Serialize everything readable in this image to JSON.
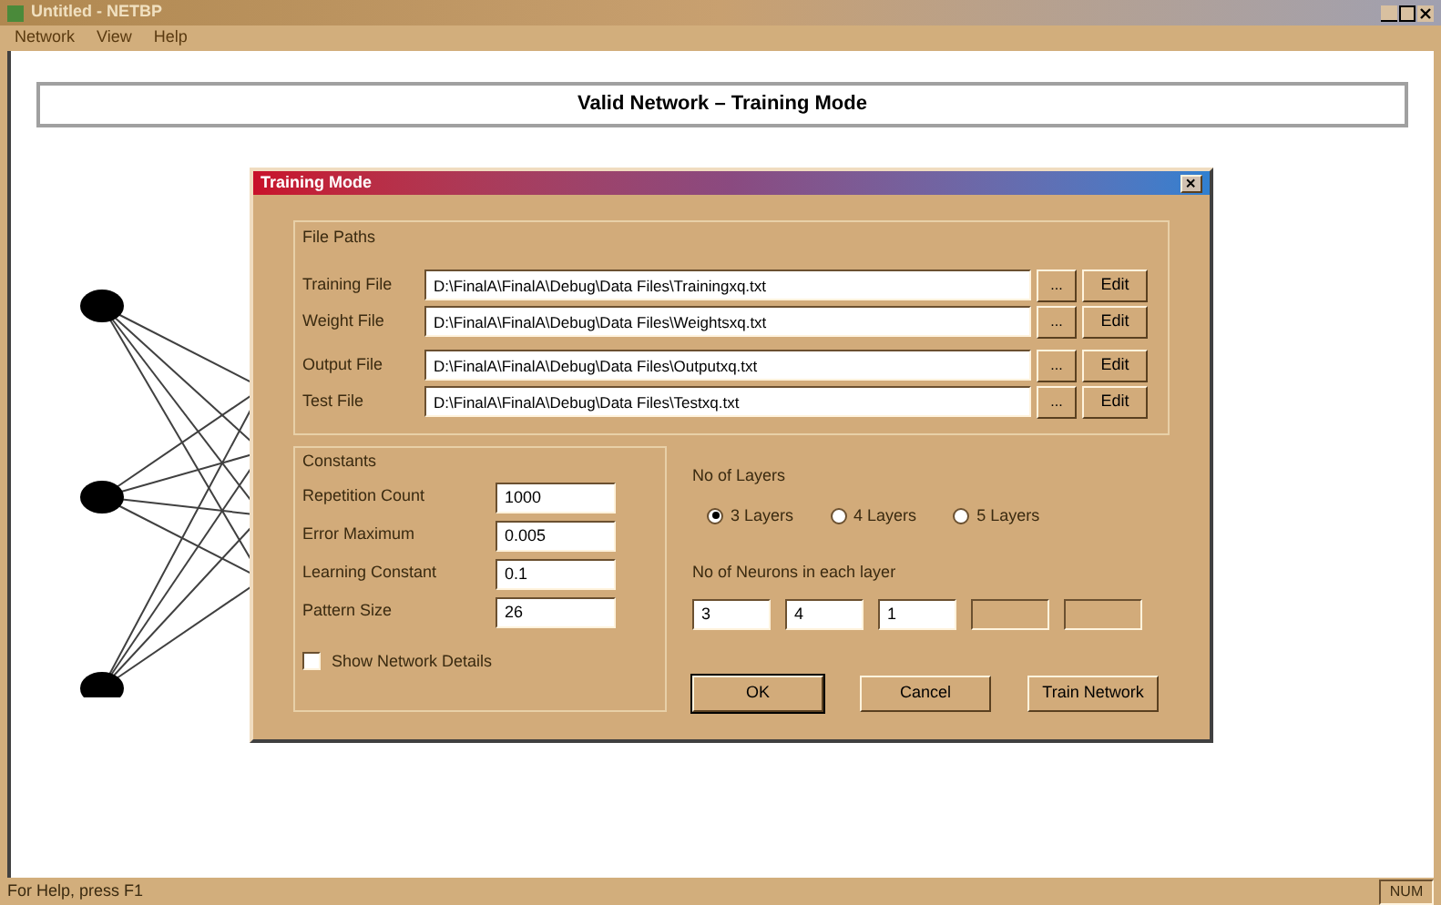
{
  "window": {
    "title": "Untitled - NETBP"
  },
  "menu": [
    "Network",
    "View",
    "Help"
  ],
  "heading": "Valid Network – Training Mode",
  "dialog": {
    "title": "Training Mode",
    "file_paths": {
      "label": "File Paths",
      "rows": [
        {
          "label": "Training File",
          "value": "D:\\FinalA\\FinalA\\Debug\\Data Files\\Trainingxq.txt",
          "browse": "...",
          "edit": "Edit"
        },
        {
          "label": "Weight File",
          "value": "D:\\FinalA\\FinalA\\Debug\\Data Files\\Weightsxq.txt",
          "browse": "...",
          "edit": "Edit"
        },
        {
          "label": "Output File",
          "value": "D:\\FinalA\\FinalA\\Debug\\Data Files\\Outputxq.txt",
          "browse": "...",
          "edit": "Edit"
        },
        {
          "label": "Test File",
          "value": "D:\\FinalA\\FinalA\\Debug\\Data Files\\Testxq.txt",
          "browse": "...",
          "edit": "Edit"
        }
      ]
    },
    "constants": {
      "label": "Constants",
      "fields": [
        {
          "label": "Repetition Count",
          "value": "1000"
        },
        {
          "label": "Error Maximum",
          "value": "0.005"
        },
        {
          "label": "Learning Constant",
          "value": "0.1"
        },
        {
          "label": "Pattern Size",
          "value": "26"
        }
      ]
    },
    "show_details": {
      "label": "Show Network Details",
      "checked": false
    },
    "layers": {
      "label": "No of Layers",
      "options": [
        {
          "label": "3 Layers",
          "selected": true
        },
        {
          "label": "4 Layers",
          "selected": false
        },
        {
          "label": "5 Layers",
          "selected": false
        }
      ]
    },
    "neurons": {
      "label": "No of Neurons in each layer",
      "fields": [
        {
          "value": "3",
          "disabled": false
        },
        {
          "value": "4",
          "disabled": false
        },
        {
          "value": "1",
          "disabled": false
        },
        {
          "disabled": true
        },
        {
          "disabled": true
        }
      ]
    },
    "buttons": [
      "OK",
      "Cancel",
      "Train Network"
    ]
  },
  "status_bar": {
    "text": "For Help, press F1",
    "indicator": "NUM"
  }
}
